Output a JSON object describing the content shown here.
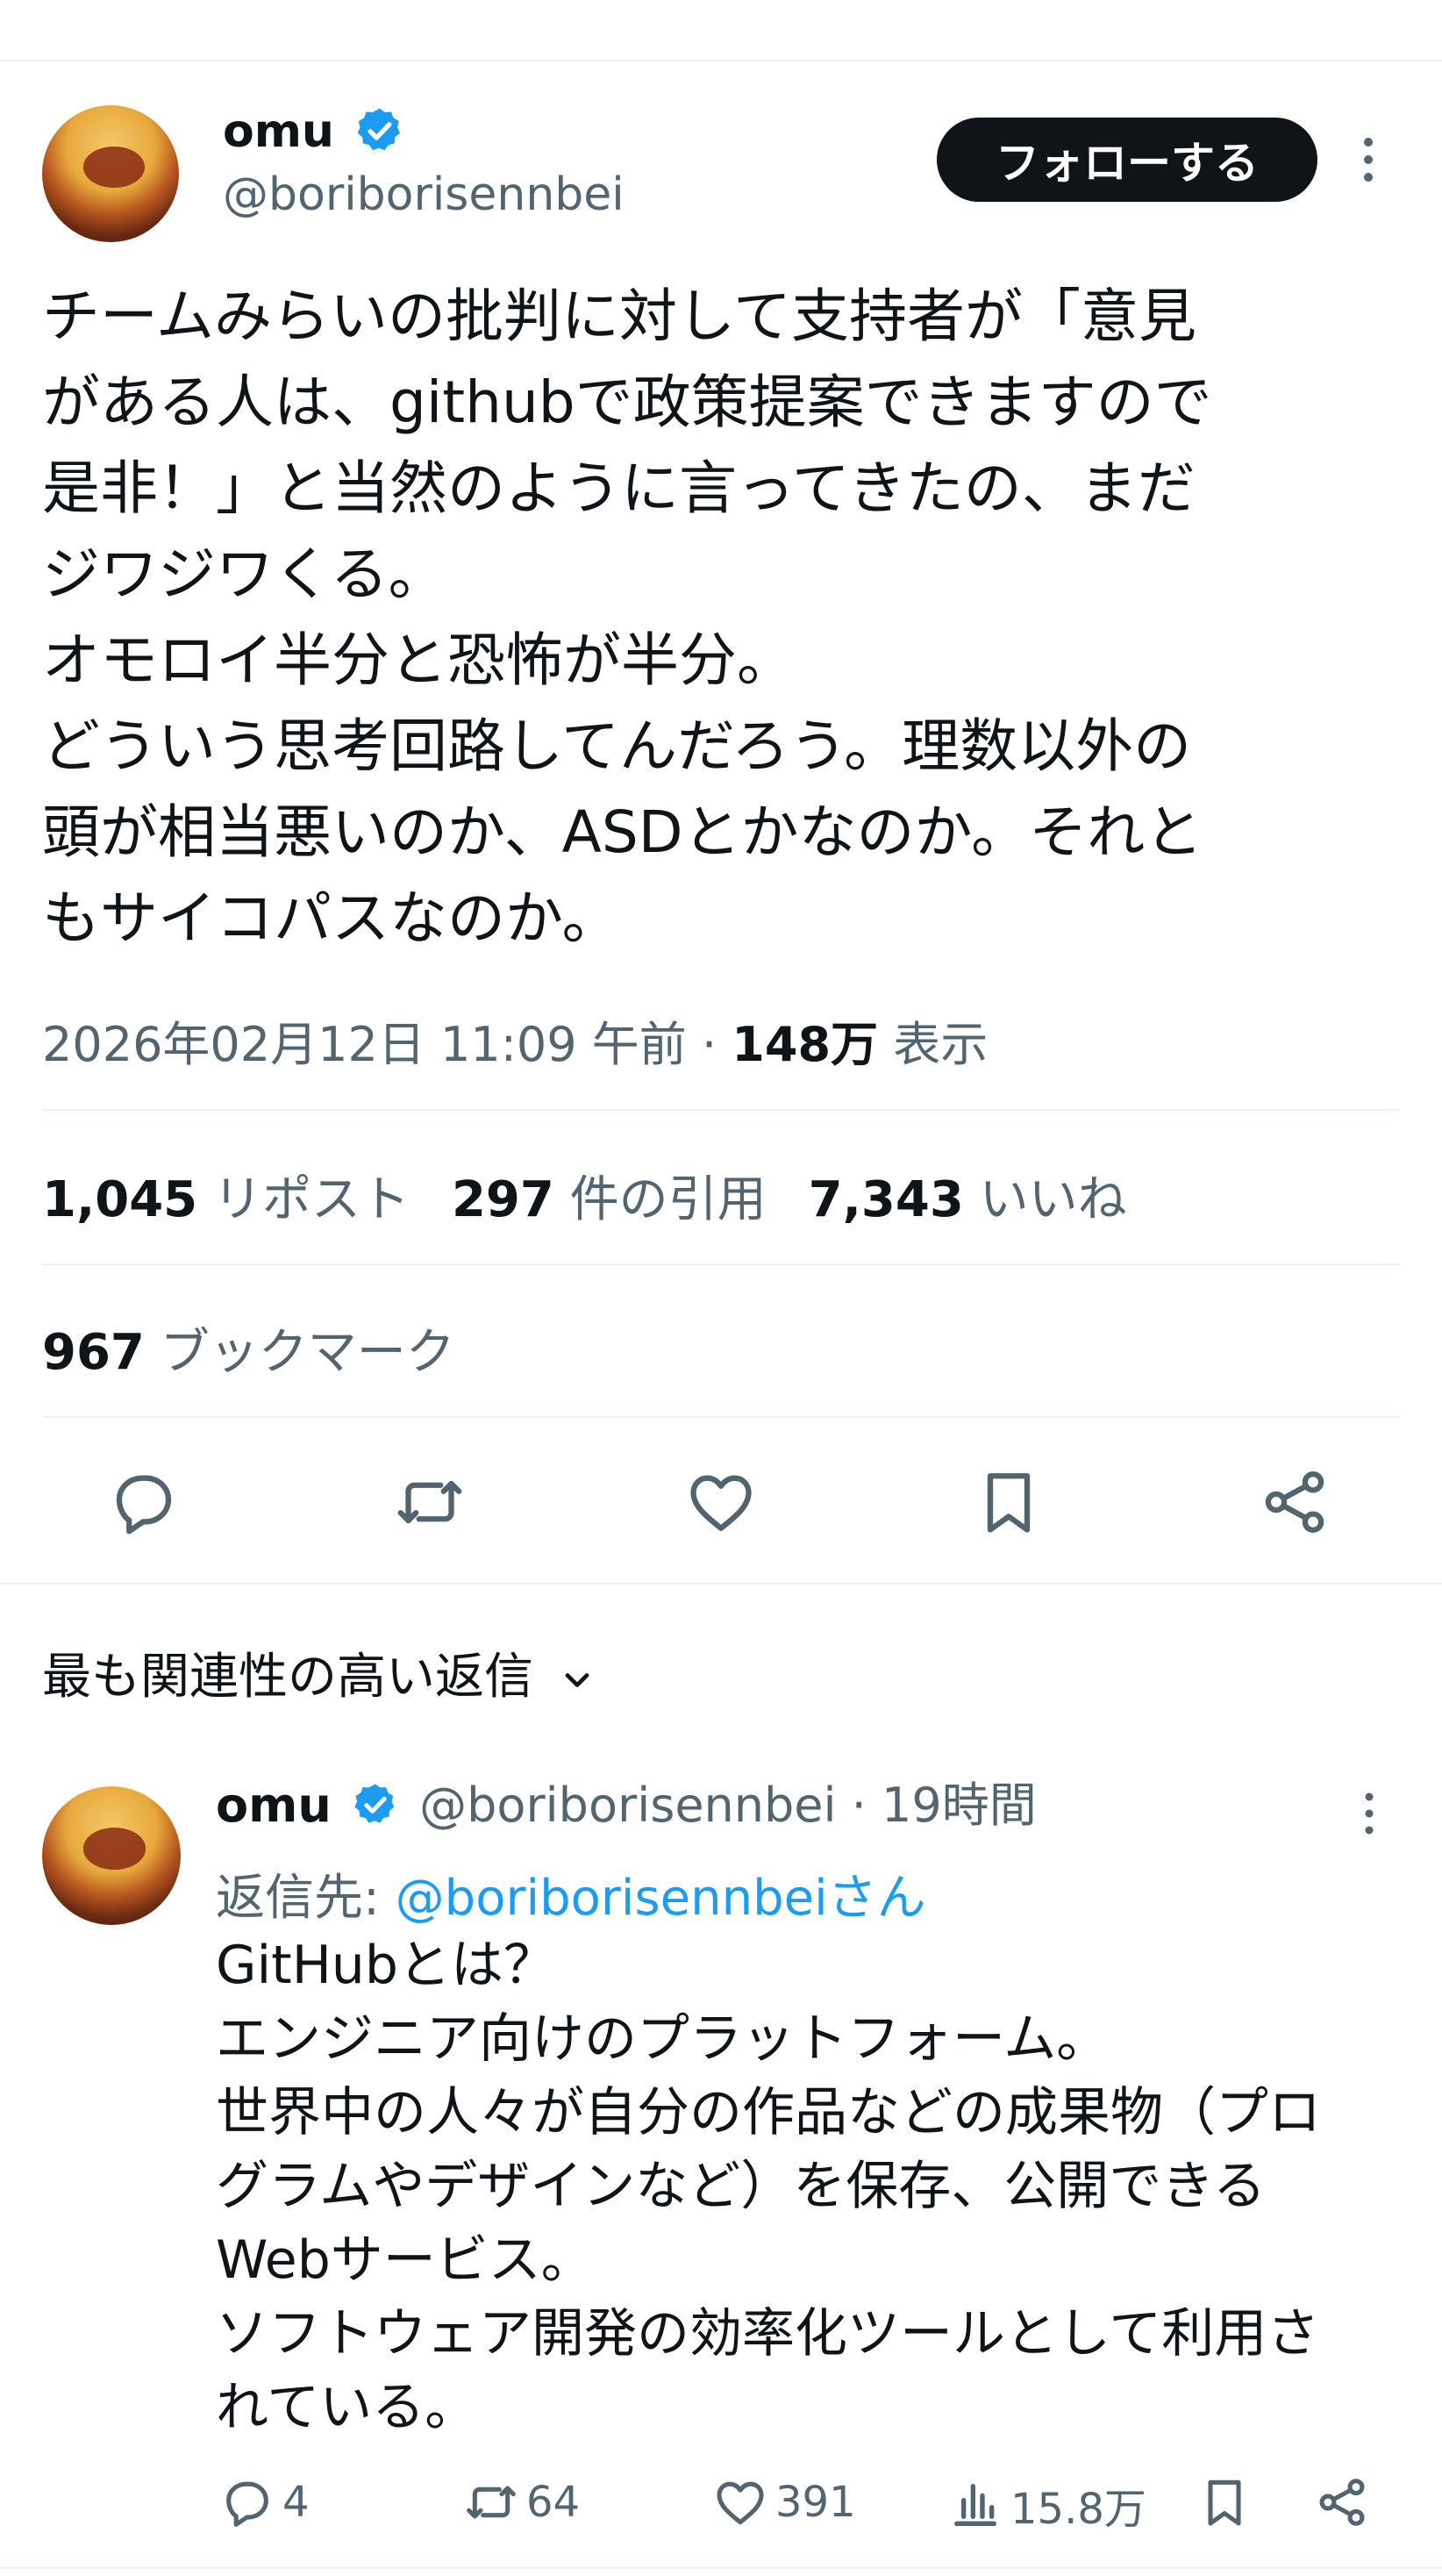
{
  "tweet": {
    "display_name": "omu",
    "handle": "@boriborisennbei",
    "follow_label": "フォローする",
    "text": "チームみらいの批判に対して支持者が「意見\nがある人は、githubで政策提案できますので\n是非！」と当然のように言ってきたの、まだ\nジワジワくる。\nオモロイ半分と恐怖が半分。\nどういう思考回路してんだろう。理数以外の\n頭が相当悪いのか、ASDとかなのか。それと\nもサイコパスなのか。",
    "timestamp": "2026年02月12日 11:09 午前 · ",
    "views_count": "148万",
    "views_label": " 表示",
    "stats": {
      "reposts_count": "1,045",
      "reposts_label": "リポスト",
      "quotes_count": "297",
      "quotes_label": "件の引用",
      "likes_count": "7,343",
      "likes_label": "いいね",
      "bookmarks_count": "967",
      "bookmarks_label": "ブックマーク"
    }
  },
  "replies_section": {
    "sort_label": "最も関連性の高い返信"
  },
  "reply": {
    "display_name": "omu",
    "handle": "@boriborisennbei",
    "time": " · 19時間",
    "reply_to_prefix": "返信先: ",
    "reply_to_mention": "@boriborisennbeiさん",
    "text": "GitHubとは？\nエンジニア向けのプラットフォーム。\n世界中の人々が自分の作品などの成果物（プロ\nグラムやデザインなど）を保存、公開できる\nWebサービス。\nソフトウェア開発の効率化ツールとして利用さ\nれている。",
    "replies_count": "4",
    "reposts_count": "64",
    "likes_count": "391",
    "views_count": "15.8万"
  },
  "colors": {
    "text": "#0f1419",
    "secondary": "#536471",
    "accent": "#1d9bf0",
    "divider": "#eff3f4"
  },
  "icons": [
    "verified-badge-icon",
    "more-icon",
    "reply-icon",
    "repost-icon",
    "like-icon",
    "bookmark-icon",
    "share-icon",
    "chevron-down-icon",
    "views-icon"
  ]
}
